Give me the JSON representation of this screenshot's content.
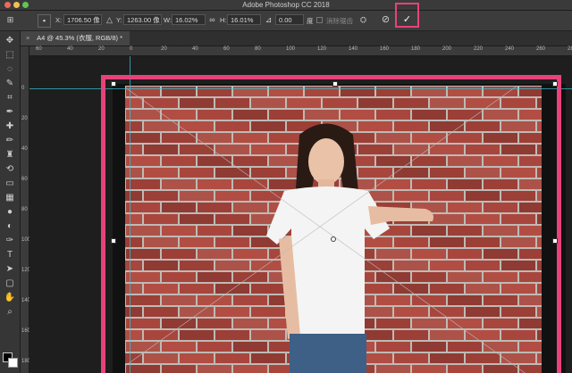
{
  "window": {
    "title": "Adobe Photoshop CC 2018",
    "traffic_colors": [
      "#ed6a5e",
      "#f4bf4f",
      "#61c554"
    ]
  },
  "options_bar": {
    "x_label": "X:",
    "x_value": "1706.50 像",
    "y_label": "Y:",
    "y_value": "1263.00 像",
    "w_label": "W:",
    "w_value": "16.02%",
    "h_label": "H:",
    "h_value": "16.01%",
    "angle_value": "0.00",
    "angle_unit": "度",
    "antialias_label": "消除锯齿",
    "commit_icon": "✓",
    "cancel_icon": "⊘"
  },
  "document_tab": {
    "label": "A4 @ 45.3% (衣服, RGB/8) *"
  },
  "ruler": {
    "h_ticks": [
      "60",
      "40",
      "20",
      "0",
      "20",
      "40",
      "60",
      "80",
      "100",
      "120",
      "140",
      "160",
      "180",
      "200",
      "220",
      "240",
      "260",
      "280"
    ],
    "v_ticks": [
      "0",
      "20",
      "40",
      "60",
      "80",
      "100",
      "120",
      "140",
      "160",
      "180"
    ]
  },
  "toolbar": {
    "tools": [
      "move-icon",
      "marquee-icon",
      "lasso-icon",
      "quick-select-icon",
      "crop-icon",
      "eyedropper-icon",
      "healing-icon",
      "brush-icon",
      "stamp-icon",
      "history-brush-icon",
      "eraser-icon",
      "gradient-icon",
      "blur-icon",
      "dodge-icon",
      "pen-icon",
      "type-icon",
      "path-select-icon",
      "shape-icon",
      "hand-icon",
      "zoom-icon"
    ]
  },
  "colors": {
    "accent_highlight": "#e8427a",
    "guide": "#35c7d8"
  }
}
